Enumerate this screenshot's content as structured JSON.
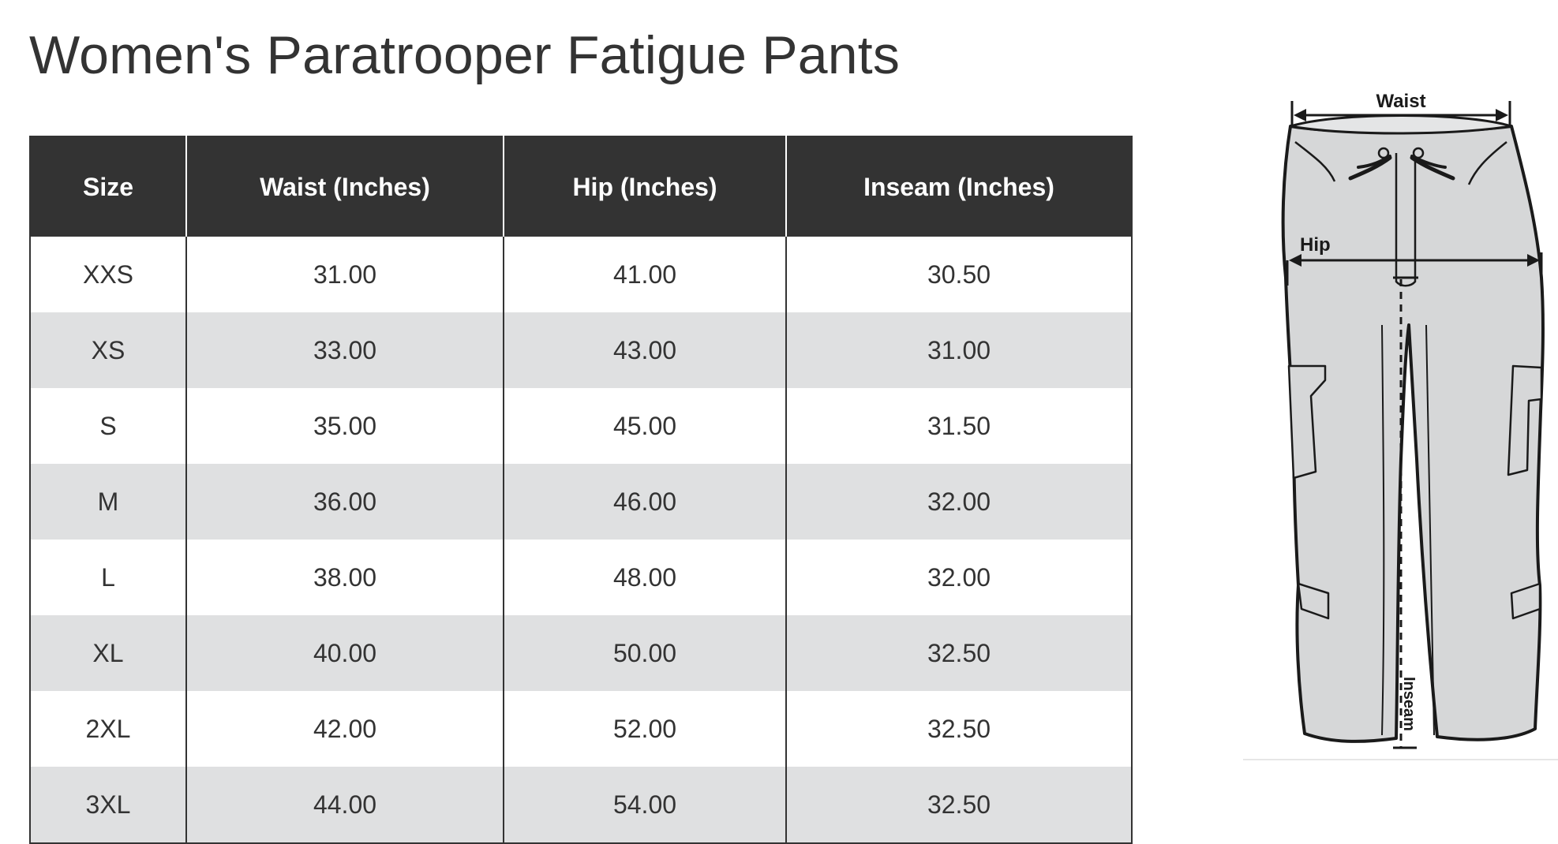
{
  "page": {
    "title": "Women's Paratrooper Fatigue Pants"
  },
  "table": {
    "headers": {
      "size": "Size",
      "waist": "Waist (Inches)",
      "hip": "Hip (Inches)",
      "inseam": "Inseam (Inches)"
    },
    "rows": [
      {
        "size": "XXS",
        "waist": "31.00",
        "hip": "41.00",
        "inseam": "30.50"
      },
      {
        "size": "XS",
        "waist": "33.00",
        "hip": "43.00",
        "inseam": "31.00"
      },
      {
        "size": "S",
        "waist": "35.00",
        "hip": "45.00",
        "inseam": "31.50"
      },
      {
        "size": "M",
        "waist": "36.00",
        "hip": "46.00",
        "inseam": "32.00"
      },
      {
        "size": "L",
        "waist": "38.00",
        "hip": "48.00",
        "inseam": "32.00"
      },
      {
        "size": "XL",
        "waist": "40.00",
        "hip": "50.00",
        "inseam": "32.50"
      },
      {
        "size": "2XL",
        "waist": "42.00",
        "hip": "52.00",
        "inseam": "32.50"
      },
      {
        "size": "3XL",
        "waist": "44.00",
        "hip": "54.00",
        "inseam": "32.50"
      }
    ]
  },
  "diagram": {
    "labels": {
      "waist": "Waist",
      "hip": "Hip",
      "inseam": "Inseam"
    }
  },
  "colors": {
    "header_bg": "#333333",
    "header_text": "#ffffff",
    "row_alt_bg": "#dfe0e1",
    "text": "#333333",
    "pants_fill": "#d6d7d8"
  }
}
